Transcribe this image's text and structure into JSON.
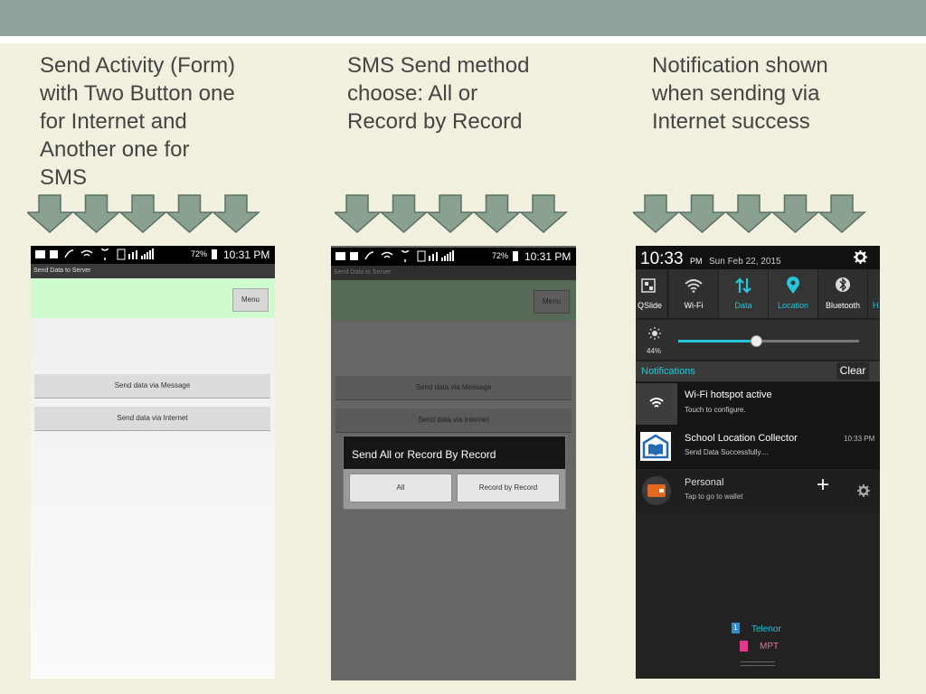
{
  "captions": {
    "col1": [
      "Send Activity (Form)",
      "with Two Button one",
      "for Internet and",
      "Another one for",
      "SMS"
    ],
    "col2": [
      "SMS Send method",
      "choose: All or",
      "Record by Record"
    ],
    "col3": [
      "Notification shown",
      "when sending via",
      "Internet success"
    ]
  },
  "colors": {
    "accent": "#26c6da",
    "arrow": "#8aa192",
    "actionbar": "#cffccf"
  },
  "phone1": {
    "battery": "72%",
    "time": "10:31 PM",
    "title": "Send Data to Server",
    "menu": "Menu",
    "btn_message": "Send data via Message",
    "btn_internet": "Send data via Internet"
  },
  "phone2": {
    "battery": "72%",
    "time": "10:31 PM",
    "title": "Send Data to Server",
    "menu": "Menu",
    "btn_message": "Send data via Message",
    "btn_internet": "Send data via Internet",
    "dialog_title": "Send All or Record By Record",
    "dialog_all": "All",
    "dialog_record": "Record by Record"
  },
  "phone3": {
    "time": "10:33",
    "ampm": "PM",
    "date": "Sun Feb 22, 2015",
    "tiles": [
      "QSlide",
      "Wi-Fi",
      "Data",
      "Location",
      "Bluetooth",
      "H"
    ],
    "brightness": "44%",
    "brightness_level": 0.43,
    "notifications_label": "Notifications",
    "clear": "Clear",
    "n1_title": "Wi-Fi hotspot active",
    "n1_sub": "Touch to configure.",
    "n2_title": "School Location Collector",
    "n2_sub": "Send Data Successfully....",
    "n2_time": "10:33 PM",
    "n3_title": "Personal",
    "n3_sub": "Tap to go to wallet",
    "sim1_num": "1",
    "sim1": "Telenor",
    "sim2": "MPT"
  }
}
